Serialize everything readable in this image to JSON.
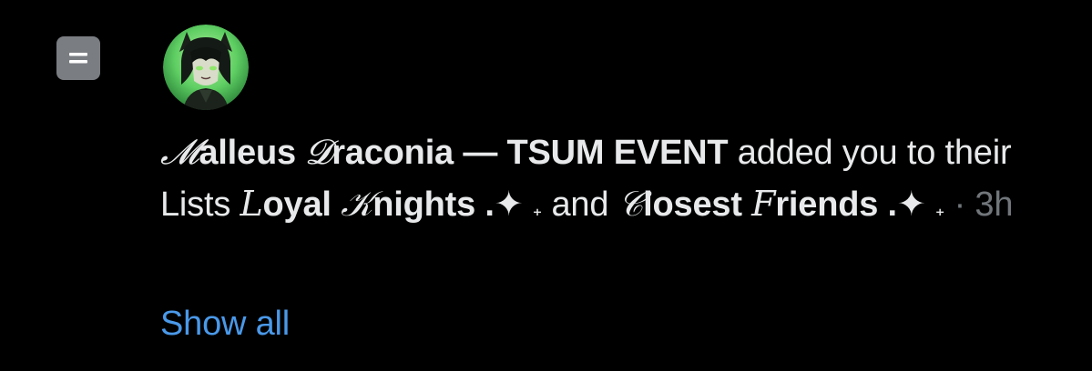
{
  "notification": {
    "icon": "list-icon",
    "avatar": "user-avatar",
    "actor": {
      "name_initial": "𝓜",
      "name_rest": "alleus ",
      "name_initial2": "𝓓",
      "name_rest2": "raconia — TSUM EVENT"
    },
    "action_text": " added you to their Lists ",
    "list1": {
      "initial": "𝐿",
      "rest": "oyal ",
      "initial2": "𝒦",
      "rest2": "nights .",
      "sparkle": "✦",
      "sparkle_small": "₊"
    },
    "conjunction": " and ",
    "list2": {
      "initial": "𝒞",
      "rest": "losest ",
      "initial2": "𝐹",
      "rest2": "riends .",
      "sparkle": "✦",
      "sparkle_small": "₊"
    },
    "separator": " · ",
    "timestamp": "3h",
    "show_all_label": "Show all"
  },
  "colors": {
    "background": "#000000",
    "text": "#e7e9ea",
    "secondary_text": "#71767b",
    "link": "#4a99e9",
    "icon_bg": "#7a7d82"
  }
}
